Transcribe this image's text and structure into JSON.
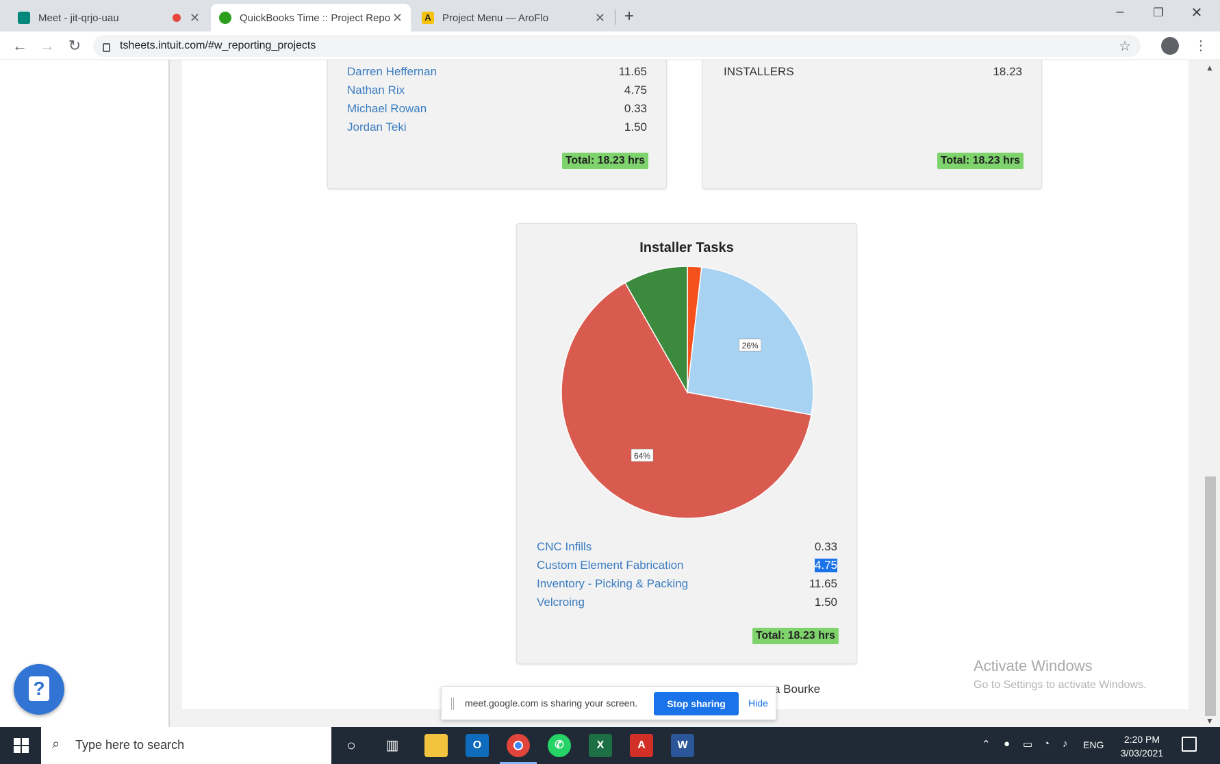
{
  "browser": {
    "tabs": [
      {
        "title": "Meet - jit-qrjo-uau",
        "favicon_color": "#00897b"
      },
      {
        "title": "QuickBooks Time :: Project Repor",
        "favicon_color": "#2ca01c"
      },
      {
        "title": "Project Menu — AroFlo",
        "favicon_color": "#f4c20d"
      }
    ],
    "new_tab_label": "+",
    "url": "tsheets.intuit.com/#w_reporting_projects",
    "window_controls": {
      "minimize": "–",
      "restore": "❐",
      "close": "✕"
    }
  },
  "people_card": {
    "rows": [
      {
        "name": "Darren Heffernan",
        "value": "11.65"
      },
      {
        "name": "Nathan Rix",
        "value": "4.75"
      },
      {
        "name": "Michael Rowan",
        "value": "0.33"
      },
      {
        "name": "Jordan Teki",
        "value": "1.50"
      }
    ],
    "total": "Total: 18.23 hrs"
  },
  "groups_card": {
    "rows": [
      {
        "name": "INSTALLERS",
        "value": "18.23"
      }
    ],
    "total": "Total: 18.23 hrs"
  },
  "tasks_card": {
    "title": "Installer Tasks",
    "rows": [
      {
        "name": "CNC Infills",
        "value": "0.33"
      },
      {
        "name": "Custom Element Fabrication",
        "value": "4.75"
      },
      {
        "name": "Inventory - Picking & Packing",
        "value": "11.65"
      },
      {
        "name": "Velcroing",
        "value": "1.50"
      }
    ],
    "total": "Total: 18.23 hrs"
  },
  "chart_data": {
    "type": "pie",
    "title": "Installer Tasks",
    "categories": [
      "CNC Infills",
      "Custom Element Fabrication",
      "Inventory - Picking & Packing",
      "Velcroing"
    ],
    "values": [
      0.33,
      4.75,
      11.65,
      1.5
    ],
    "colors": [
      "#f4511e",
      "#a8d2f2",
      "#d95a4e",
      "#3b8a3e"
    ],
    "slice_labels": [
      "",
      "26%",
      "64%",
      ""
    ],
    "start_angle_deg": 0,
    "direction": "clockwise"
  },
  "footer_name": "a Bourke",
  "watermark": {
    "line1": "Activate Windows",
    "line2": "Go to Settings to activate Windows."
  },
  "screen_share": {
    "text": "meet.google.com is sharing your screen.",
    "stop_label": "Stop sharing",
    "hide_label": "Hide"
  },
  "help_icon_glyph": "?",
  "taskbar": {
    "search_placeholder": "Type here to search",
    "apps": [
      "cortana-icon",
      "task-view-icon",
      "file-explorer-icon",
      "outlook-icon",
      "chrome-icon",
      "whatsapp-icon",
      "excel-icon",
      "acrobat-icon",
      "word-icon"
    ],
    "language": "ENG",
    "time": "2:20 PM",
    "date": "3/03/2021"
  }
}
